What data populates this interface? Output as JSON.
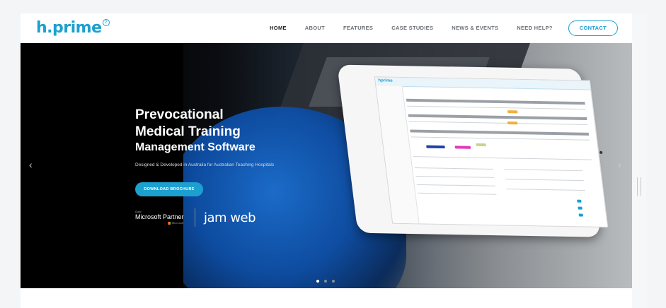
{
  "header": {
    "logo_text": "h.prime",
    "logo_sup": "2",
    "nav": [
      {
        "label": "HOME",
        "active": true
      },
      {
        "label": "ABOUT"
      },
      {
        "label": "FEATURES"
      },
      {
        "label": "CASE STUDIES"
      },
      {
        "label": "NEWS & EVENTS"
      },
      {
        "label": "NEED HELP?"
      }
    ],
    "contact_label": "CONTACT"
  },
  "hero": {
    "title_line1": "Prevocational",
    "title_line2": "Medical Training",
    "title_line3": "Management Software",
    "subtitle": "Designed & Developed in Australia for Australian Teaching Hospitals",
    "brochure_label": "DOWNLOAD BROCHURE",
    "partner_gold": "Gold",
    "partner_name": "Microsoft Partner",
    "partner_sub": "Microsoft",
    "jam_left": "jam",
    "jam_dot": ".",
    "jam_right": "web",
    "tablet_logo": "hprime",
    "prev_icon": "chevron-left-icon",
    "next_icon": "chevron-right-icon",
    "slides": 3,
    "active_slide": 1
  },
  "colors": {
    "accent": "#1ba0d0",
    "nav_text": "#6b6f75",
    "jam_dot": "#c21d54"
  }
}
